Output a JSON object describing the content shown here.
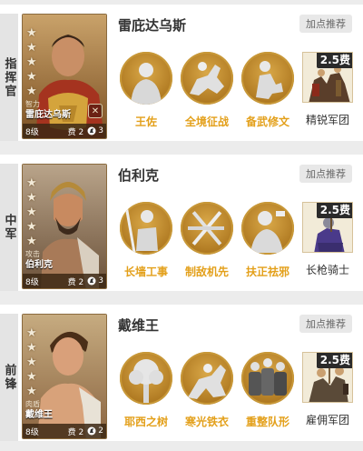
{
  "rows": [
    {
      "slot": "指挥官",
      "hero": {
        "name": "雷庇达乌斯",
        "card_type": "智力",
        "card_name": "雷庇达乌斯",
        "level": "8级",
        "cost": "费 2",
        "count": "3",
        "stars": 5,
        "shield_glyph": "✕"
      },
      "recommend_label": "加点推荐",
      "skills": [
        {
          "name": "王佐",
          "icon": "warrior-bust-icon"
        },
        {
          "name": "全境征战",
          "icon": "charging-horse-icon"
        },
        {
          "name": "备武修文",
          "icon": "kneeling-figure-icon"
        }
      ],
      "troop": {
        "name": "精锐军团",
        "cost": "2.5费",
        "icon": "legion-soldiers-icon"
      }
    },
    {
      "slot": "中军",
      "hero": {
        "name": "伯利克",
        "card_type": "攻击",
        "card_name": "伯利克",
        "level": "8级",
        "cost": "费 2",
        "count": "3",
        "stars": 5,
        "shield_glyph": ""
      },
      "recommend_label": "加点推荐",
      "skills": [
        {
          "name": "长墙工事",
          "icon": "spearman-icon"
        },
        {
          "name": "制敌机先",
          "icon": "crossed-swords-icon"
        },
        {
          "name": "扶正祛邪",
          "icon": "soldier-shouting-icon"
        }
      ],
      "troop": {
        "name": "长枪骑士",
        "cost": "2.5费",
        "icon": "lance-knight-icon"
      }
    },
    {
      "slot": "前锋",
      "hero": {
        "name": "戴维王",
        "card_type": "肉盾",
        "card_name": "戴维王",
        "level": "8级",
        "cost": "费 2",
        "count": "2",
        "stars": 5,
        "shield_glyph": ""
      },
      "recommend_label": "加点推荐",
      "skills": [
        {
          "name": "耶西之树",
          "icon": "tree-icon"
        },
        {
          "name": "寒光铁衣",
          "icon": "armored-rider-icon"
        },
        {
          "name": "重整队形",
          "icon": "shield-wall-icon"
        }
      ],
      "troop": {
        "name": "雇佣军团",
        "cost": "2.5费",
        "icon": "mercenary-band-icon"
      }
    }
  ],
  "colors": {
    "skill_name": "#e3a01b",
    "skill_bg": "#c08a2e",
    "cost_badge_bg": "#2a2a2a",
    "page_bg": "#ececec"
  }
}
